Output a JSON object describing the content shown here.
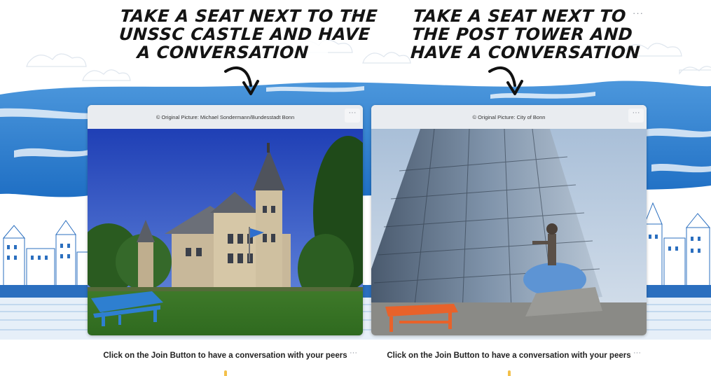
{
  "left_panel": {
    "heading_lines": [
      "TAKE A SEAT NEXT TO THE",
      "UNSSC CASTLE AND HAVE",
      "A CONVERSATION"
    ],
    "caption": "© Original Picture: Michael Sondermann/Bundesstadt Bonn",
    "info_text": "Click on the Join Button to have a conversation with your peers",
    "bench_color": "#2e7fd0",
    "menu_icon": "ellipsis-icon"
  },
  "right_panel": {
    "heading_lines": [
      "TAKE A SEAT NEXT TO",
      "THE POST TOWER AND",
      "HAVE A CONVERSATION"
    ],
    "caption": "© Original Picture: City of Bonn",
    "info_text": "Click on the Join Button to have a conversation with your peers",
    "bench_color": "#e8622a",
    "menu_icon": "ellipsis-icon"
  },
  "menu_dots": "···",
  "colors": {
    "brush_blue": "#2b7fd4",
    "card_header_bg": "#e9ecf0",
    "heading_text": "#141414"
  }
}
